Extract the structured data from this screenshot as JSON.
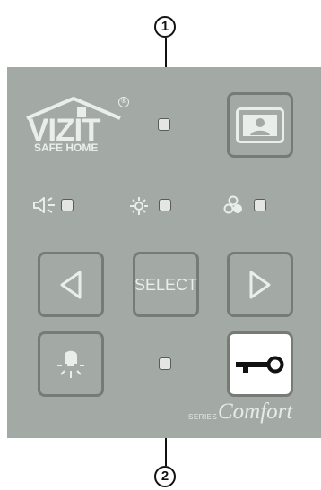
{
  "callouts": {
    "top": "1",
    "bottom": "2"
  },
  "logo": {
    "brand": "VIZIT",
    "tagline": "SAFE HOME",
    "registered_mark": "®"
  },
  "buttons": {
    "select_label": "SELECT"
  },
  "series": {
    "prefix": "SERIES",
    "name": "Comfort"
  },
  "icons": {
    "photo": "portrait-icon",
    "volume": "volume-icon",
    "brightness": "brightness-icon",
    "color": "color-icon",
    "left": "left-arrow-icon",
    "right": "right-arrow-icon",
    "light": "light-icon",
    "key": "key-icon"
  },
  "colors": {
    "panel": "#a3a9a4",
    "stroke": "#777b78",
    "icon": "#e9eeeb",
    "led": "#e3e6e4"
  }
}
